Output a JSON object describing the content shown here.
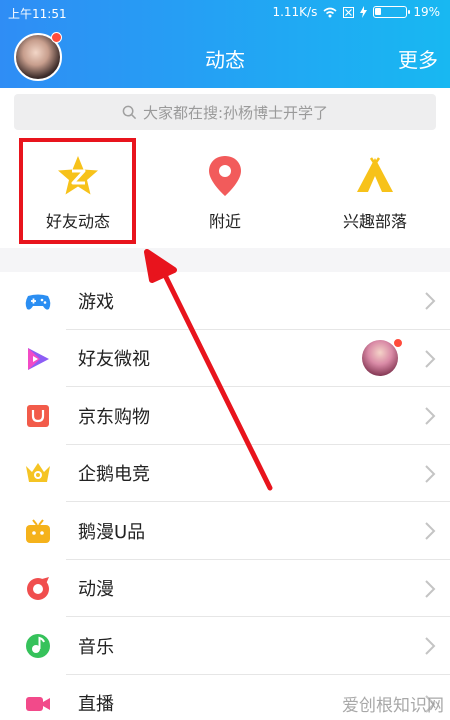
{
  "status_bar": {
    "time": "上午11:51",
    "speed": "1.11K/s",
    "battery": "19%",
    "battery_level": 0.19
  },
  "header": {
    "title": "动态",
    "more": "更多"
  },
  "search": {
    "placeholder": "大家都在搜:孙杨博士开学了"
  },
  "quick_actions": [
    {
      "label": "好友动态",
      "icon": "qzone-star-icon"
    },
    {
      "label": "附近",
      "icon": "location-pin-icon"
    },
    {
      "label": "兴趣部落",
      "icon": "tent-icon"
    }
  ],
  "list": [
    {
      "label": "游戏",
      "icon": "gamepad-icon"
    },
    {
      "label": "好友微视",
      "icon": "play-triangle-icon"
    },
    {
      "label": "京东购物",
      "icon": "shopping-bag-icon"
    },
    {
      "label": "企鹅电竞",
      "icon": "esports-crown-icon"
    },
    {
      "label": "鹅漫U品",
      "icon": "tv-box-icon"
    },
    {
      "label": "动漫",
      "icon": "anime-icon"
    },
    {
      "label": "音乐",
      "icon": "music-note-icon"
    },
    {
      "label": "直播",
      "icon": "video-camera-icon"
    }
  ],
  "colors": {
    "header_start": "#2f8df5",
    "header_end": "#18b8f2",
    "highlight": "#e8141d"
  },
  "watermark": "爱创根知识网"
}
